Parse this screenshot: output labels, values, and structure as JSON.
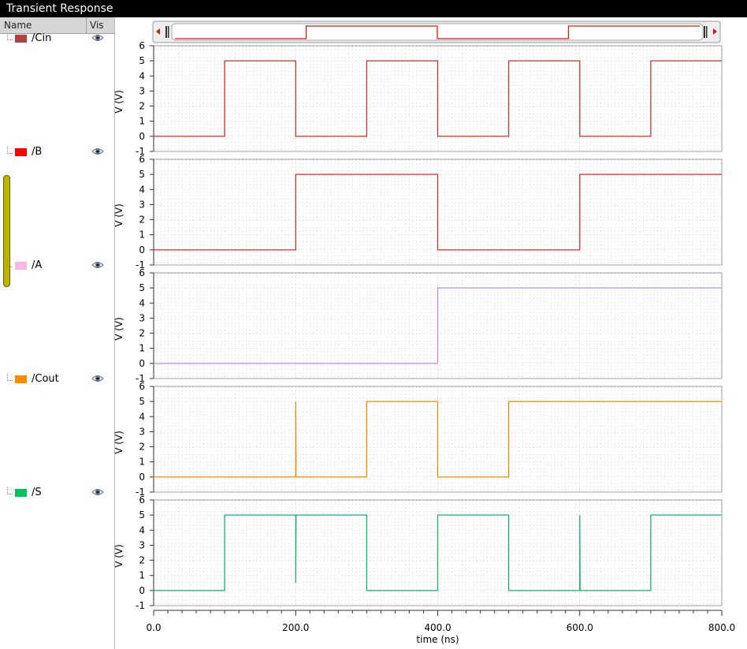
{
  "window": {
    "title": "Transient Response"
  },
  "panel": {
    "name_header": "Name",
    "vis_header": "Vis"
  },
  "signals": [
    {
      "name": "/Cin",
      "color": "#b0413e",
      "trace_color": "#c8322d"
    },
    {
      "name": "/B",
      "color": "#ff0000",
      "trace_color": "#d92b2b"
    },
    {
      "name": "/A",
      "color": "#f5b8e8",
      "trace_color": "#c58ad6"
    },
    {
      "name": "/Cout",
      "color": "#ff8c00",
      "trace_color": "#f08a00"
    },
    {
      "name": "/S",
      "color": "#00c060",
      "trace_color": "#13b36a"
    }
  ],
  "icons": {
    "visibility": "eye-icon",
    "scroll_left": "left-arrow-icon",
    "scroll_right": "right-arrow-icon"
  },
  "chart_data": [
    {
      "type": "line",
      "signal": "/Cin",
      "ylabel": "V (V)",
      "ylim": [
        -1,
        6
      ],
      "yticks": [
        -1,
        0,
        1,
        2,
        3,
        4,
        5,
        6
      ],
      "xlim": [
        0,
        800
      ],
      "x": [
        0,
        100,
        100,
        200,
        200,
        300,
        300,
        400,
        400,
        500,
        500,
        600,
        600,
        700,
        700,
        800
      ],
      "y": [
        0,
        0,
        5,
        5,
        0,
        0,
        5,
        5,
        0,
        0,
        5,
        5,
        0,
        0,
        5,
        5
      ]
    },
    {
      "type": "line",
      "signal": "/B",
      "ylabel": "V (V)",
      "ylim": [
        -1,
        6
      ],
      "yticks": [
        -1,
        0,
        1,
        2,
        3,
        4,
        5,
        6
      ],
      "xlim": [
        0,
        800
      ],
      "x": [
        0,
        200,
        200,
        400,
        400,
        600,
        600,
        800
      ],
      "y": [
        0,
        0,
        5,
        5,
        0,
        0,
        5,
        5
      ]
    },
    {
      "type": "line",
      "signal": "/A",
      "ylabel": "V (V)",
      "ylim": [
        -1,
        6
      ],
      "yticks": [
        -1,
        0,
        1,
        2,
        3,
        4,
        5,
        6
      ],
      "xlim": [
        0,
        800
      ],
      "x": [
        0,
        400,
        400,
        800
      ],
      "y": [
        0,
        0,
        5,
        5
      ]
    },
    {
      "type": "line",
      "signal": "/Cout",
      "ylabel": "V (V)",
      "ylim": [
        -1,
        6
      ],
      "yticks": [
        -1,
        0,
        1,
        2,
        3,
        4,
        5,
        6
      ],
      "xlim": [
        0,
        800
      ],
      "x": [
        0,
        200,
        200,
        200.5,
        200.5,
        300,
        300,
        400,
        400,
        500,
        500,
        800
      ],
      "y": [
        0,
        0,
        5,
        1.4,
        0,
        0,
        5,
        5,
        0,
        0,
        5,
        5
      ]
    },
    {
      "type": "line",
      "signal": "/S",
      "ylabel": "V (V)",
      "ylim": [
        -1,
        6
      ],
      "yticks": [
        -1,
        0,
        1,
        2,
        3,
        4,
        5,
        6
      ],
      "xlim": [
        0,
        800
      ],
      "x": [
        0,
        100,
        100,
        200,
        200,
        200.5,
        200.5,
        300,
        300,
        400,
        400,
        500,
        500,
        600,
        600,
        600.5,
        600.5,
        700,
        700,
        800
      ],
      "y": [
        0,
        0,
        5,
        5,
        0.5,
        4.7,
        5,
        5,
        0,
        0,
        5,
        5,
        0,
        0,
        5,
        0.2,
        0,
        0,
        5,
        5
      ]
    }
  ],
  "x_axis": {
    "label": "time (ns)",
    "ticks": [
      0,
      200,
      400,
      600,
      800
    ],
    "tick_labels": [
      "0.0",
      "200.0",
      "400.0",
      "600.0",
      "800.0"
    ]
  },
  "overview": {
    "x": [
      0,
      200,
      200,
      400,
      400,
      600,
      600,
      800
    ],
    "y": [
      0,
      0,
      1,
      1,
      0,
      0,
      1,
      1
    ]
  }
}
